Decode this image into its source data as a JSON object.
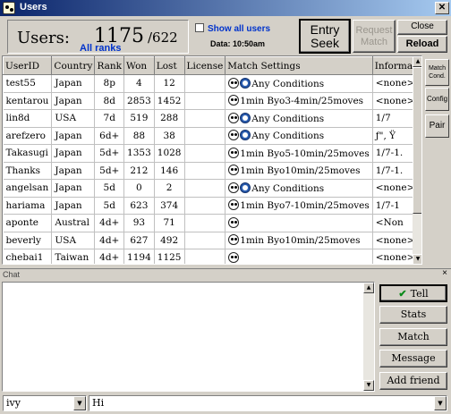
{
  "window": {
    "title": "Users",
    "close_glyph": "✕"
  },
  "header": {
    "users_label": "Users:",
    "users_count": "1175",
    "users_total": "/622",
    "ranks_filter": "All ranks",
    "show_all_label": "Show all users",
    "data_time": "Data: 10:50am"
  },
  "buttons": {
    "entry_seek_line1": "Entry",
    "entry_seek_line2": "Seek",
    "request_match_line1": "Request",
    "request_match_line2": "Match",
    "close": "Close",
    "reload": "Reload"
  },
  "side_buttons": {
    "match_cond_line1": "Match",
    "match_cond_line2": "Cond.",
    "config": "Config",
    "pair": "Pair"
  },
  "table": {
    "columns": [
      "UserID",
      "Country",
      "Rank",
      "Won",
      "Lost",
      "License",
      "Match Settings",
      "Information"
    ],
    "rows": [
      {
        "user": "test55",
        "country": "Japan",
        "rank": "8p",
        "won": "4",
        "lost": "12",
        "license": "",
        "icons": [
          "panda-icon",
          "clock-icon"
        ],
        "settings": "Any Conditions",
        "info": "<none>"
      },
      {
        "user": "kentarou",
        "country": "Japan",
        "rank": "8d",
        "won": "2853",
        "lost": "1452",
        "license": "",
        "icons": [
          "panda-icon"
        ],
        "settings": "1min Byo3-4min/25moves",
        "info": "<none>"
      },
      {
        "user": "lin8d",
        "country": "USA",
        "rank": "7d",
        "won": "519",
        "lost": "288",
        "license": "",
        "icons": [
          "panda-icon",
          "clock-icon"
        ],
        "settings": "Any Conditions",
        "info": "1/7"
      },
      {
        "user": "arefzero",
        "country": "Japan",
        "rank": "6d+",
        "won": "88",
        "lost": "38",
        "license": "",
        "icons": [
          "panda-icon",
          "clock-icon"
        ],
        "settings": "Any Conditions",
        "info": "ƒ\", Ÿ"
      },
      {
        "user": "Takasugi",
        "country": "Japan",
        "rank": "5d+",
        "won": "1353",
        "lost": "1028",
        "license": "",
        "icons": [
          "panda-icon"
        ],
        "settings": "1min Byo5-10min/25moves",
        "info": "1/7-1."
      },
      {
        "user": "Thanks",
        "country": "Japan",
        "rank": "5d+",
        "won": "212",
        "lost": "146",
        "license": "",
        "icons": [
          "panda-icon"
        ],
        "settings": "1min Byo10min/25moves",
        "info": "1/7-1."
      },
      {
        "user": "angelsan",
        "country": "Japan",
        "rank": "5d",
        "won": "0",
        "lost": "2",
        "license": "",
        "icons": [
          "panda-icon",
          "clock-icon"
        ],
        "settings": "Any Conditions",
        "info": "<none>"
      },
      {
        "user": "hariama",
        "country": "Japan",
        "rank": "5d",
        "won": "623",
        "lost": "374",
        "license": "",
        "icons": [
          "panda-icon"
        ],
        "settings": "1min Byo7-10min/25moves",
        "info": "1/7-1"
      },
      {
        "user": "aponte",
        "country": "Austral",
        "rank": "4d+",
        "won": "93",
        "lost": "71",
        "license": "",
        "icons": [
          "panda-icon"
        ],
        "settings": "",
        "info": "<Non"
      },
      {
        "user": "beverly",
        "country": "USA",
        "rank": "4d+",
        "won": "627",
        "lost": "492",
        "license": "",
        "icons": [
          "panda-icon"
        ],
        "settings": "1min Byo10min/25moves",
        "info": "<none>"
      },
      {
        "user": "chebai1",
        "country": "Taiwan",
        "rank": "4d+",
        "won": "1194",
        "lost": "1125",
        "license": "",
        "icons": [
          "panda-icon"
        ],
        "settings": "",
        "info": "<none>"
      }
    ]
  },
  "chat": {
    "title": "Chat",
    "close_glyph": "×",
    "tell_label": "Tell",
    "tell_check": "✔",
    "stats_label": "Stats",
    "match_label": "Match",
    "message_label": "Message",
    "add_friend_label": "Add friend",
    "recipient": "ivy",
    "message": "Hi"
  }
}
